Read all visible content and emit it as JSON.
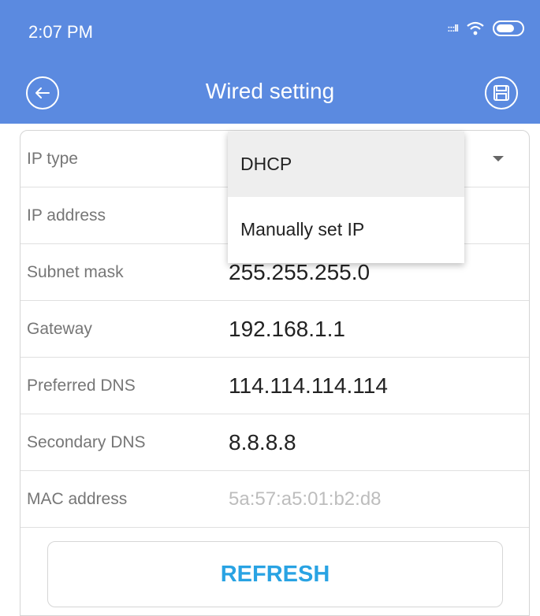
{
  "status_bar": {
    "time": "2:07 PM",
    "signal_text": ":::ll"
  },
  "header": {
    "title": "Wired setting",
    "back_icon": "back-arrow-icon",
    "save_icon": "save-icon",
    "color": "#5b8ae0"
  },
  "form": {
    "rows": [
      {
        "label": "IP type",
        "value": "DHCP"
      },
      {
        "label": "IP address",
        "value": ""
      },
      {
        "label": "Subnet mask",
        "value": "255.255.255.0"
      },
      {
        "label": "Gateway",
        "value": "192.168.1.1"
      },
      {
        "label": "Preferred DNS",
        "value": "114.114.114.114"
      },
      {
        "label": "Secondary DNS",
        "value": "8.8.8.8"
      },
      {
        "label": "MAC address",
        "value": "5a:57:a5:01:b2:d8"
      }
    ]
  },
  "dropdown": {
    "options": [
      "DHCP",
      "Manually set IP"
    ],
    "selected": "DHCP"
  },
  "actions": {
    "refresh_label": "REFRESH",
    "accent": "#29a3e3"
  }
}
